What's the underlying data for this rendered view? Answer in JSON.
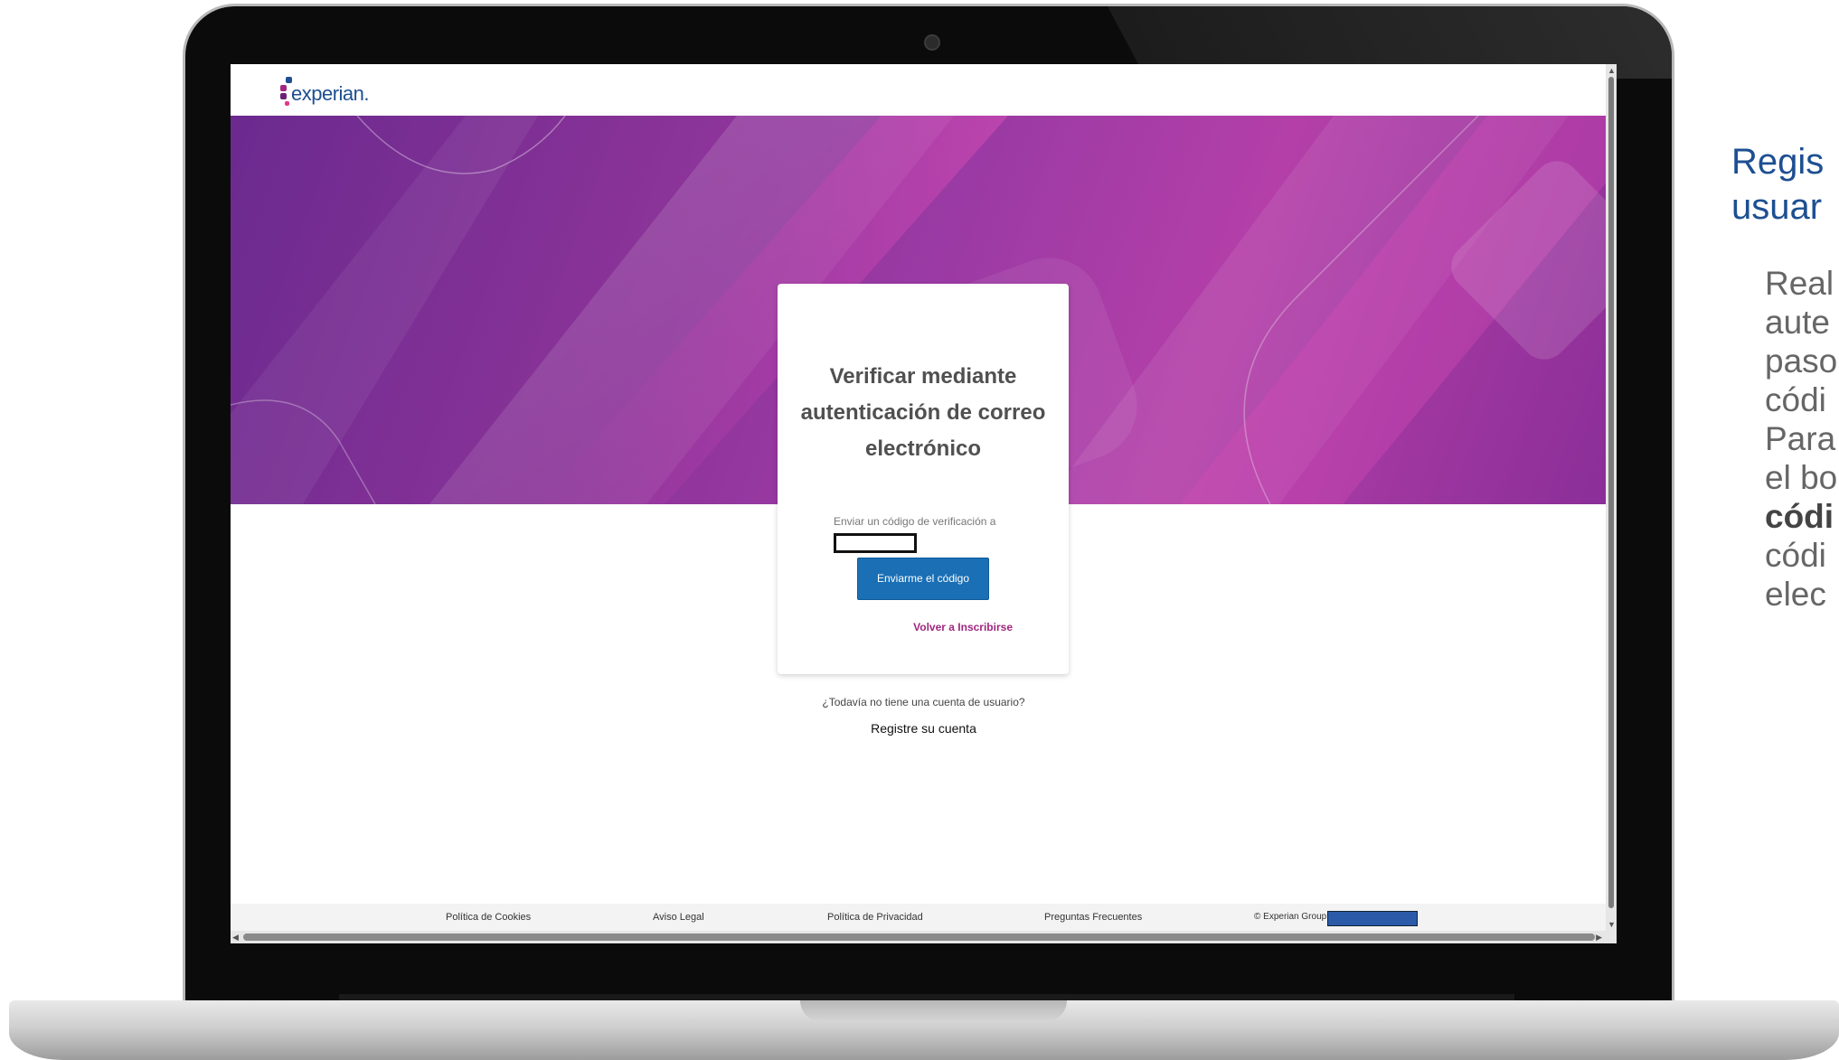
{
  "brand": {
    "name": "experian.",
    "dot_colors": [
      "#1d4f91",
      "#a0277f",
      "#6d2077",
      "#e63888"
    ]
  },
  "card": {
    "title": "Verificar mediante autenticación de correo electrónico",
    "subtitle": "Enviar un código de verificación a",
    "send_button": "Enviarme el código",
    "back_link": "Volver a Inscribirse"
  },
  "signup": {
    "question": "¿Todavía no tiene una cuenta de usuario?",
    "link": "Registre su cuenta"
  },
  "footer": {
    "links": [
      "Política de Cookies",
      "Aviso Legal",
      "Política de Privacidad",
      "Preguntas Frecuentes"
    ],
    "copyright": "© Experian Group -"
  },
  "side_panel": {
    "title_lines": [
      "Regis",
      "usuar"
    ],
    "body_lines": [
      "Real",
      "aute",
      "paso",
      "códi",
      "Para",
      "el bo",
      "códi",
      "códi",
      "elec"
    ],
    "bold_line_index": 6
  },
  "colors": {
    "accent_blue": "#1a6fb5",
    "link_magenta": "#a0277f",
    "hero_purple": "#8a3398",
    "side_title_blue": "#1d4f91"
  }
}
